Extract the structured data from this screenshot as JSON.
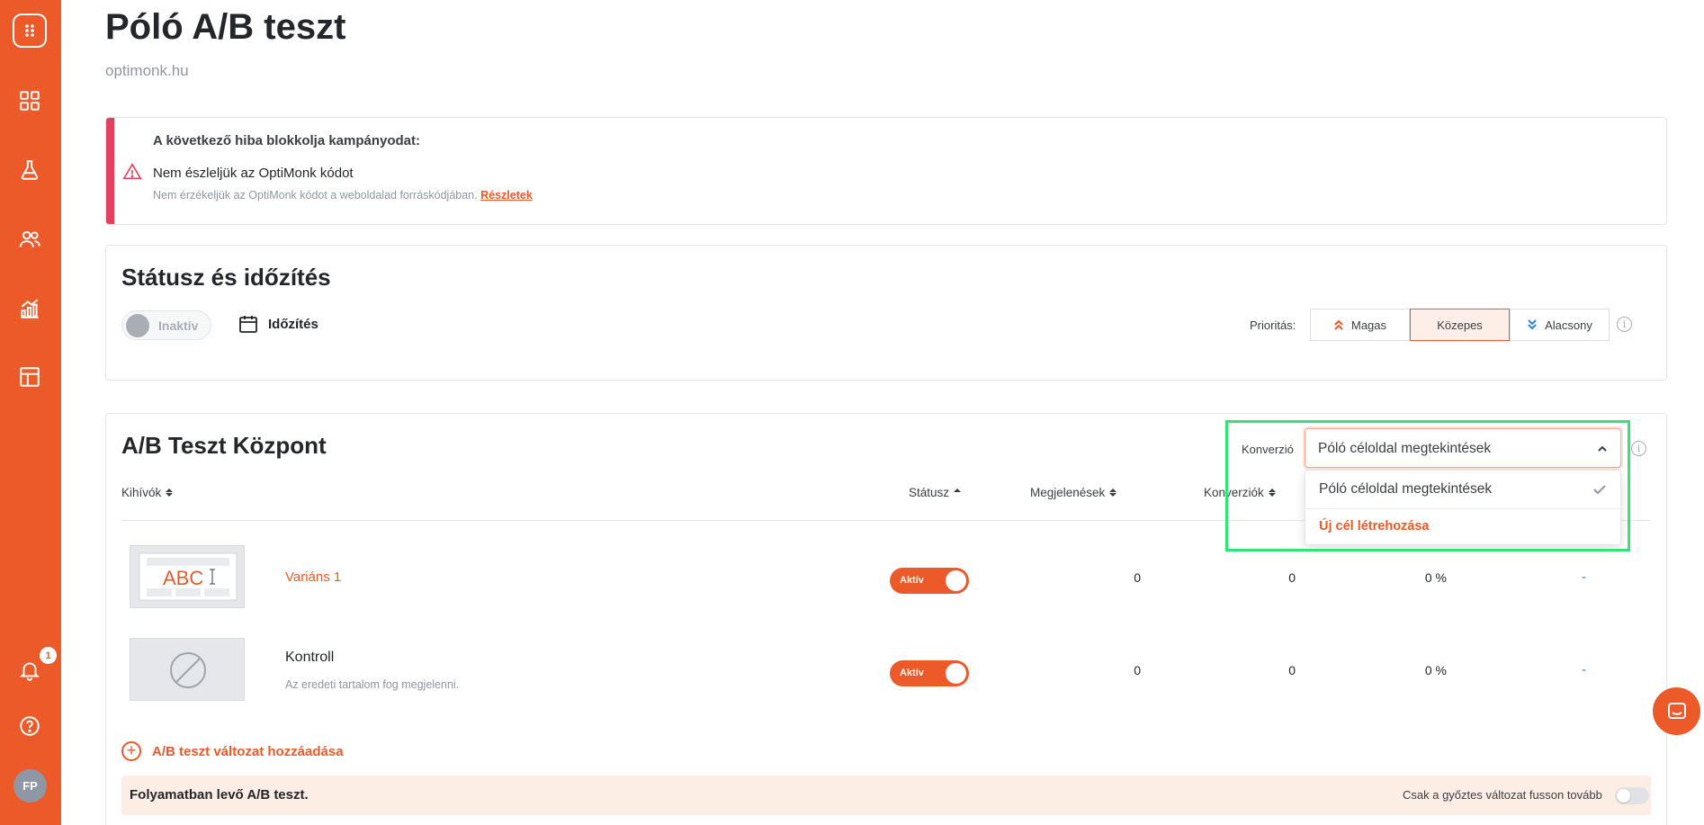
{
  "page": {
    "title": "Póló A/B teszt",
    "domain": "optimonk.hu"
  },
  "sidebar": {
    "items": [
      {
        "icon": "logo-icon"
      },
      {
        "icon": "dashboard-grid-icon"
      },
      {
        "icon": "flask-icon"
      },
      {
        "icon": "users-icon"
      },
      {
        "icon": "analytics-chart-icon"
      },
      {
        "icon": "templates-layout-icon"
      },
      {
        "icon": "bell-icon"
      },
      {
        "icon": "help-icon"
      }
    ],
    "notification_count": "1",
    "avatar_initials": "FP"
  },
  "error_card": {
    "heading": "A következő hiba blokkolja kampányodat:",
    "title": "Nem észleljük az OptiMonk kódot",
    "description": "Nem érzékeljük az OptiMonk kódot a weboldalad forráskódjában.",
    "link": "Részletek"
  },
  "status_card": {
    "title": "Státusz és időzítés",
    "status_toggle_label": "Inaktív",
    "schedule_label": "Időzítés",
    "priority_label": "Prioritás:",
    "priority_options": [
      "Magas",
      "Közepes",
      "Alacsony"
    ],
    "priority_selected": "Közepes"
  },
  "ab_card": {
    "title": "A/B Teszt Központ",
    "conversion_label": "Konverzió",
    "conversion_selected": "Póló céloldal megtekintések",
    "conversion_options": [
      "Póló céloldal megtekintések"
    ],
    "create_goal_label": "Új cél létrehozása",
    "columns": {
      "variants": "Kihívók",
      "status": "Státusz",
      "impressions": "Megjelenések",
      "conversions": "Konverziók"
    },
    "rows": [
      {
        "name": "Variáns 1",
        "status": "Aktív",
        "impressions": "0",
        "conversions": "0",
        "rate": "0 %",
        "uplift": "-",
        "thumbnail_text": "ABC"
      },
      {
        "name": "Kontroll",
        "description": "Az eredeti tartalom fog megjelenni.",
        "status": "Aktív",
        "impressions": "0",
        "conversions": "0",
        "rate": "0 %",
        "uplift": "-"
      }
    ],
    "add_variant_label": "A/B teszt változat hozzáadása",
    "running_label": "Folyamatban levő A/B teszt.",
    "winner_only_label": "Csak a győztes változat fusson tovább"
  },
  "colors": {
    "brand": "#ed5a29",
    "error": "#e4405f",
    "highlight": "#33e37a",
    "link_blue": "#2b7fe0"
  }
}
